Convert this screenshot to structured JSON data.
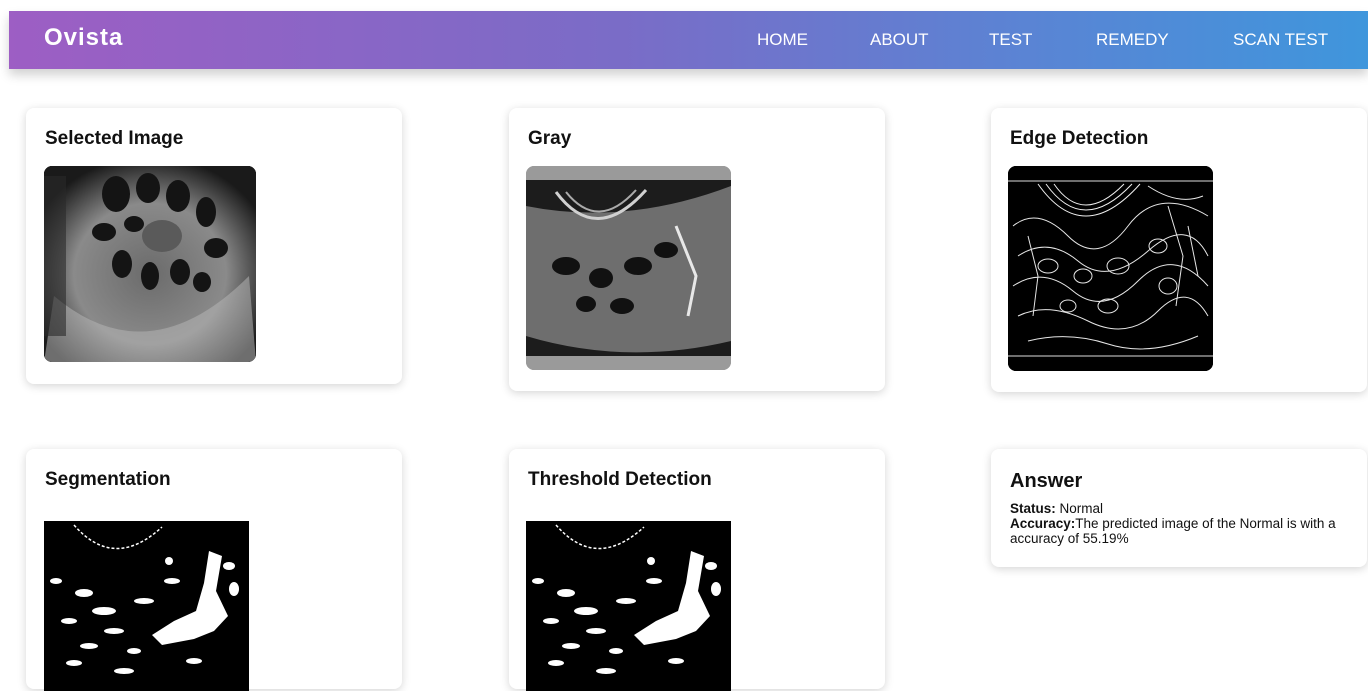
{
  "brand": "Ovista",
  "nav": [
    "HOME",
    "ABOUT",
    "TEST",
    "REMEDY",
    "SCAN TEST"
  ],
  "cards": {
    "selected_image": "Selected Image",
    "gray": "Gray",
    "edge_detection": "Edge Detection",
    "segmentation": "Segmentation",
    "threshold_detection": "Threshold Detection"
  },
  "answer": {
    "title": "Answer",
    "status_label": "Status:",
    "status_value": " Normal",
    "accuracy_label": "Accuracy:",
    "accuracy_text": "The predicted image of the Normal is with a accuracy of 55.19%"
  }
}
